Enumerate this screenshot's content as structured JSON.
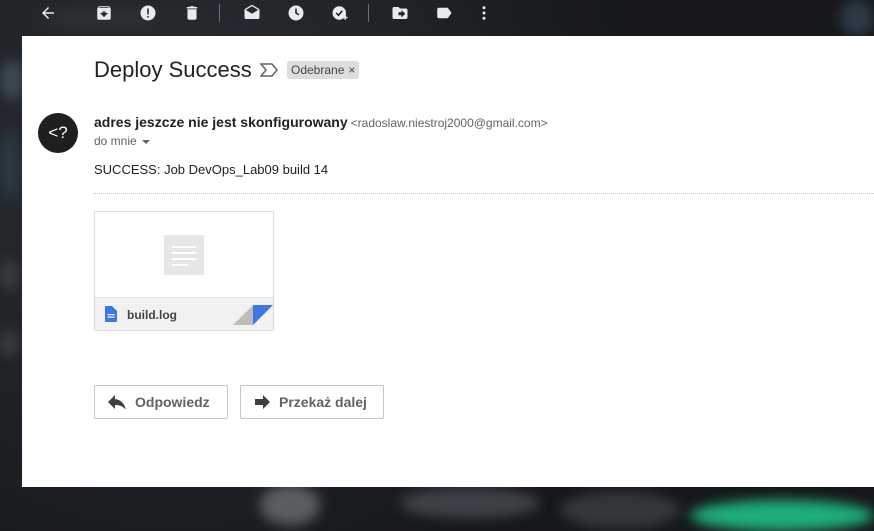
{
  "toolbar": {
    "icons": [
      "back-arrow-icon",
      "archive-icon",
      "report-spam-icon",
      "delete-icon",
      "mark-unread-icon",
      "snooze-icon",
      "add-task-icon",
      "move-to-icon",
      "label-icon",
      "more-options-icon"
    ]
  },
  "message": {
    "subject": "Deploy Success",
    "label": "Odebrane",
    "label_close": "×",
    "avatar_text": "<?",
    "sender_name": "adres jeszcze nie jest skonfigurowany",
    "sender_email": "<radoslaw.niestroj2000@gmail.com>",
    "to_me": "do mnie",
    "body": "SUCCESS: Job DevOps_Lab09 build 14"
  },
  "attachment": {
    "filename": "build.log",
    "accent_color": "#3b78e7"
  },
  "actions": {
    "reply_label": "Odpowiedz",
    "forward_label": "Przekaż dalej"
  }
}
